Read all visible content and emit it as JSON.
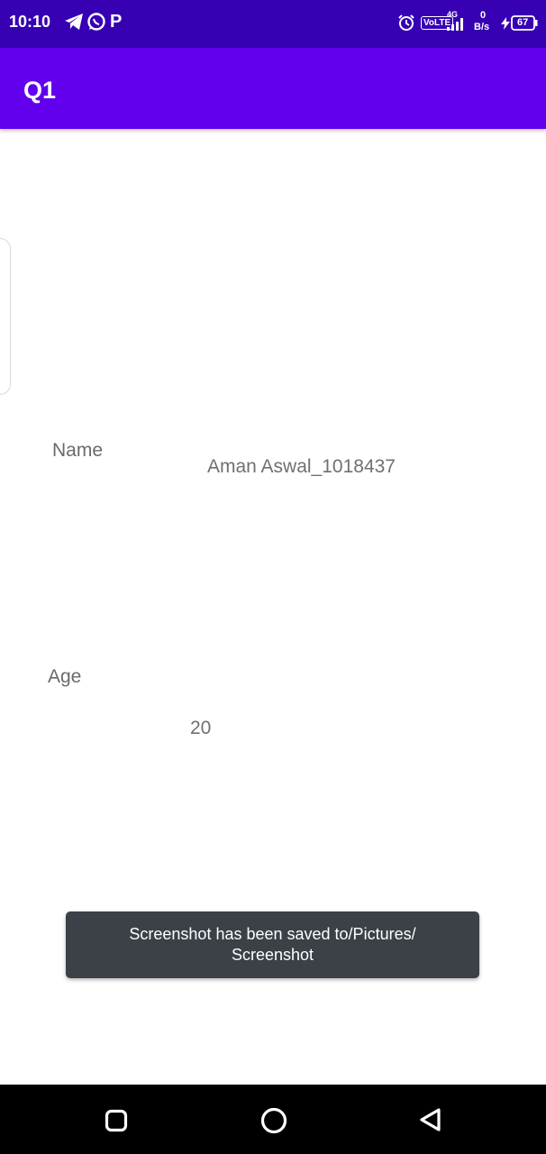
{
  "status_bar": {
    "time": "10:10",
    "network_type": "4G",
    "volte_label": "VoLTE",
    "data_rate_value": "0",
    "data_rate_unit": "B/s",
    "battery_level": "67",
    "icons": [
      "telegram-icon",
      "whatsapp-icon",
      "paytm-icon",
      "alarm-icon",
      "signal-icon",
      "charging-icon",
      "battery-icon"
    ]
  },
  "app_bar": {
    "title": "Q1",
    "color": "#6200ee",
    "status_color": "#3700b3"
  },
  "form": {
    "name_label": "Name",
    "name_value": "Aman Aswal_1018437",
    "age_label": "Age",
    "age_value": "20"
  },
  "toast": {
    "message": "Screenshot has been saved to/Pictures/ Screenshot"
  },
  "nav_bar": {
    "buttons": [
      "recents-icon",
      "home-icon",
      "back-icon"
    ]
  }
}
